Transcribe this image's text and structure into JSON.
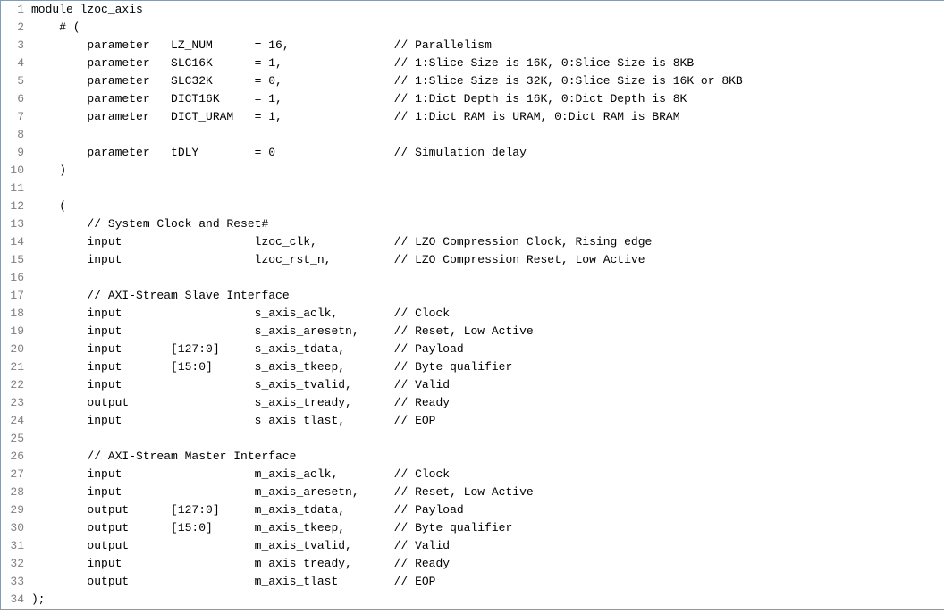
{
  "code": {
    "lines": [
      {
        "num": "1",
        "text": "module lzoc_axis"
      },
      {
        "num": "2",
        "text": "    # ("
      },
      {
        "num": "3",
        "text": "        parameter   LZ_NUM      = 16,               // Parallelism"
      },
      {
        "num": "4",
        "text": "        parameter   SLC16K      = 1,                // 1:Slice Size is 16K, 0:Slice Size is 8KB"
      },
      {
        "num": "5",
        "text": "        parameter   SLC32K      = 0,                // 1:Slice Size is 32K, 0:Slice Size is 16K or 8KB"
      },
      {
        "num": "6",
        "text": "        parameter   DICT16K     = 1,                // 1:Dict Depth is 16K, 0:Dict Depth is 8K"
      },
      {
        "num": "7",
        "text": "        parameter   DICT_URAM   = 1,                // 1:Dict RAM is URAM, 0:Dict RAM is BRAM"
      },
      {
        "num": "8",
        "text": ""
      },
      {
        "num": "9",
        "text": "        parameter   tDLY        = 0                 // Simulation delay"
      },
      {
        "num": "10",
        "text": "    )"
      },
      {
        "num": "11",
        "text": ""
      },
      {
        "num": "12",
        "text": "    ("
      },
      {
        "num": "13",
        "text": "        // System Clock and Reset#"
      },
      {
        "num": "14",
        "text": "        input                   lzoc_clk,           // LZO Compression Clock, Rising edge"
      },
      {
        "num": "15",
        "text": "        input                   lzoc_rst_n,         // LZO Compression Reset, Low Active"
      },
      {
        "num": "16",
        "text": ""
      },
      {
        "num": "17",
        "text": "        // AXI-Stream Slave Interface"
      },
      {
        "num": "18",
        "text": "        input                   s_axis_aclk,        // Clock"
      },
      {
        "num": "19",
        "text": "        input                   s_axis_aresetn,     // Reset, Low Active"
      },
      {
        "num": "20",
        "text": "        input       [127:0]     s_axis_tdata,       // Payload"
      },
      {
        "num": "21",
        "text": "        input       [15:0]      s_axis_tkeep,       // Byte qualifier"
      },
      {
        "num": "22",
        "text": "        input                   s_axis_tvalid,      // Valid"
      },
      {
        "num": "23",
        "text": "        output                  s_axis_tready,      // Ready"
      },
      {
        "num": "24",
        "text": "        input                   s_axis_tlast,       // EOP"
      },
      {
        "num": "25",
        "text": ""
      },
      {
        "num": "26",
        "text": "        // AXI-Stream Master Interface"
      },
      {
        "num": "27",
        "text": "        input                   m_axis_aclk,        // Clock"
      },
      {
        "num": "28",
        "text": "        input                   m_axis_aresetn,     // Reset, Low Active"
      },
      {
        "num": "29",
        "text": "        output      [127:0]     m_axis_tdata,       // Payload"
      },
      {
        "num": "30",
        "text": "        output      [15:0]      m_axis_tkeep,       // Byte qualifier"
      },
      {
        "num": "31",
        "text": "        output                  m_axis_tvalid,      // Valid"
      },
      {
        "num": "32",
        "text": "        input                   m_axis_tready,      // Ready"
      },
      {
        "num": "33",
        "text": "        output                  m_axis_tlast        // EOP"
      },
      {
        "num": "34",
        "text": ");"
      }
    ]
  }
}
